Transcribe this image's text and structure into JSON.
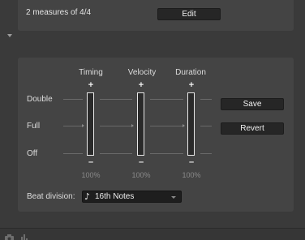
{
  "header": {
    "measures_text": "2 measures of 4/4",
    "edit_label": "Edit"
  },
  "columns": {
    "timing": "Timing",
    "velocity": "Velocity",
    "duration": "Duration"
  },
  "rows": {
    "double": "Double",
    "full": "Full",
    "off": "Off"
  },
  "markers": {
    "plus": "+",
    "minus": "–"
  },
  "sliders": {
    "timing": {
      "value": "100%"
    },
    "velocity": {
      "value": "100%"
    },
    "duration": {
      "value": "100%"
    }
  },
  "buttons": {
    "save": "Save",
    "revert": "Revert"
  },
  "beat": {
    "label": "Beat division:",
    "note_glyph": "♪",
    "value": "16th Notes"
  },
  "icons": {
    "disclosure": "disclosure-triangle-icon",
    "camera": "camera-icon",
    "levels": "levels-icon"
  }
}
